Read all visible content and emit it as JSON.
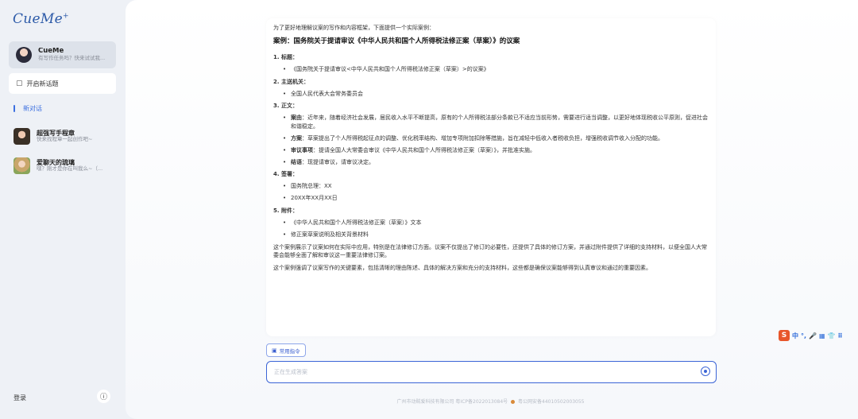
{
  "app": {
    "logo": "CueMe",
    "logo_mark": "+"
  },
  "sidebar": {
    "agent": {
      "name": "CueMe",
      "subtitle": "有写作任务吗？快来试试我..."
    },
    "new_chat_label": "开启新话题",
    "current_chat_label": "新对话",
    "history": [
      {
        "title": "超强写手程章",
        "subtitle": "快来找程章一起创作吧~"
      },
      {
        "title": "爱聊天的琉璃",
        "subtitle": "嘿？刚才是你在叫我么~（..."
      }
    ],
    "login_label": "登录"
  },
  "message": {
    "intro": "为了更好地理解议案的写作和内容框架，下面提供一个实际案例：",
    "case_title": "案例：国务院关于提请审议《中华人民共和国个人所得税法修正案（草案）》的议案",
    "sections": [
      {
        "heading": "1. 标题：",
        "items": [
          {
            "label": "",
            "text": "《国务院关于提请审议<中华人民共和国个人所得税法修正案（草案）>的议案》"
          }
        ]
      },
      {
        "heading": "2. 主送机关：",
        "items": [
          {
            "label": "",
            "text": "全国人民代表大会常务委员会"
          }
        ]
      },
      {
        "heading": "3. 正文：",
        "items": [
          {
            "label": "案由",
            "text": "：近年来，随着经济社会发展，居民收入水平不断提高，原有的个人所得税法部分条款已不适应当前形势，需要进行适当调整，以更好地体现税收公平原则，促进社会和谐稳定。"
          },
          {
            "label": "方案",
            "text": "：草案提出了个人所得税起征点的调整、优化税率结构、增加专项附加扣除等措施，旨在减轻中低收入者税收负担，增强税收调节收入分配的功能。"
          },
          {
            "label": "审议事项",
            "text": "：提请全国人大常委会审议《中华人民共和国个人所得税法修正案（草案）》，并批准实施。"
          },
          {
            "label": "结语",
            "text": "：现提请审议，请审议决定。"
          }
        ]
      },
      {
        "heading": "4. 签署：",
        "items": [
          {
            "label": "",
            "text": "国务院总理：XX"
          },
          {
            "label": "",
            "text": "20XX年XX月XX日"
          }
        ]
      },
      {
        "heading": "5. 附件：",
        "items": [
          {
            "label": "",
            "text": "《中华人民共和国个人所得税法修正案（草案）》文本"
          },
          {
            "label": "",
            "text": "修正案草案说明及相关背景材料"
          }
        ]
      }
    ],
    "summary1": "这个案例展示了议案如何在实际中应用，特别是在法律修订方面。议案不仅提出了修订的必要性，还提供了具体的修订方案，并通过附件提供了详细的支持材料，以便全国人大常委会能够全面了解和审议这一重要法律修订案。",
    "summary2": "这个案例强调了议案写作的关键要素，包括清晰的理由陈述、具体的解决方案和充分的支持材料，这些都是确保议案能够得到认真审议和通过的重要因素。"
  },
  "composer": {
    "cmd_label": "常用指令",
    "placeholder": "正在生成答案"
  },
  "footer": {
    "icp": "广州市动贼爱科技有限公司 粤ICP备2022013084号",
    "police": "粤公网安备44010502003055"
  },
  "ime": {
    "logo": "S",
    "items": [
      "中",
      "°,",
      "🎤",
      "▦",
      "👕",
      "⠿"
    ]
  },
  "colors": {
    "accent": "#3b64d6",
    "sidebar_bg": "#eef1f6"
  }
}
